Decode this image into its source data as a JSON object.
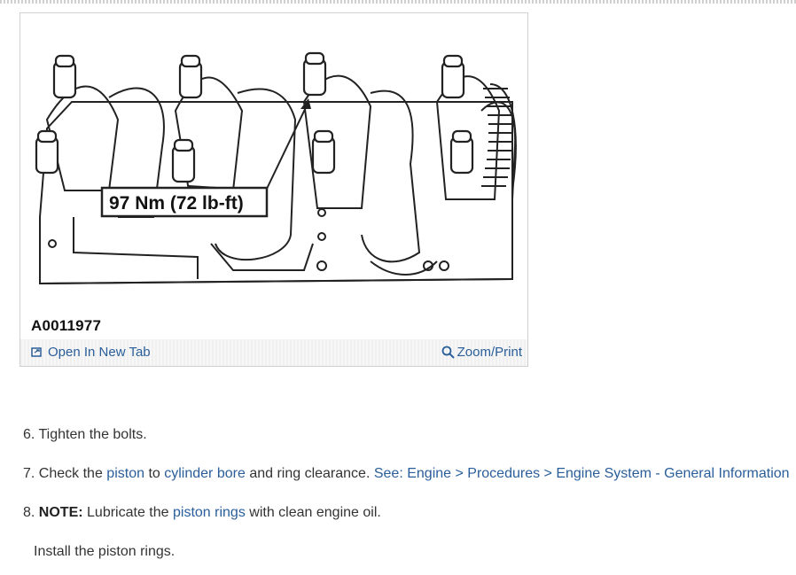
{
  "figure": {
    "callout": "97 Nm (72 lb-ft)",
    "id": "A0011977",
    "open_tab_label": "Open In New Tab",
    "zoom_label": "Zoom/Print",
    "icons": [
      "open-new-tab-icon",
      "magnifier-icon"
    ]
  },
  "steps": [
    {
      "number": "6.",
      "text": "Tighten the bolts."
    },
    {
      "number": "7.",
      "pre": "Check the",
      "link1": "piston",
      "mid1": "to",
      "link2": "cylinder bore",
      "mid2": "and ring clearance.",
      "see": "See: Engine > Procedures > Engine System - General Information"
    },
    {
      "number": "8.",
      "note_label": "NOTE:",
      "pre": "Lubricate the",
      "link": "piston rings",
      "post": "with clean engine oil."
    },
    {
      "text": "Install the piston rings."
    }
  ],
  "colors": {
    "link": "#2a5e9a",
    "text": "#333333"
  }
}
